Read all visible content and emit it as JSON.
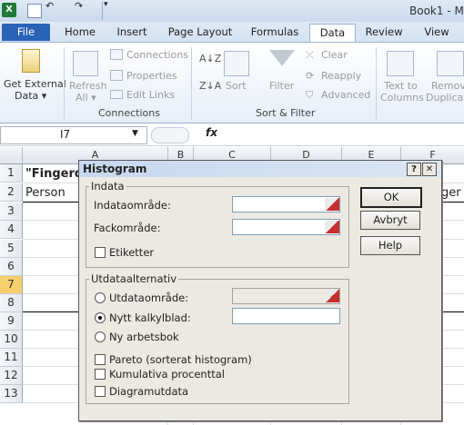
{
  "titlebar": {
    "title": "Book1 - Mi",
    "undo": "↶",
    "redo": "↷",
    "app_icon": "X"
  },
  "tabs": [
    {
      "label": "File"
    },
    {
      "label": "Home"
    },
    {
      "label": "Insert"
    },
    {
      "label": "Page Layout"
    },
    {
      "label": "Formulas"
    },
    {
      "label": "Data"
    },
    {
      "label": "Review"
    },
    {
      "label": "View"
    }
  ],
  "ribbon": {
    "get_external": [
      "Get External",
      "Data ▾"
    ],
    "connections": {
      "refresh": [
        "Refresh",
        "All ▾"
      ],
      "items": [
        "Connections",
        "Properties",
        "Edit Links"
      ],
      "group": "Connections"
    },
    "sort": {
      "sort": "Sort",
      "filter": "Filter",
      "items": [
        "Clear",
        "Reapply",
        "Advanced"
      ],
      "group": "Sort & Filter"
    },
    "tools": {
      "text_to_columns": [
        "Text to",
        "Columns"
      ],
      "remove_dup": [
        "Remov",
        "Duplica"
      ]
    }
  },
  "formula_bar": {
    "name_box": "I7",
    "fx": "fx"
  },
  "columns": [
    "A",
    "B",
    "C",
    "D",
    "E",
    "F"
  ],
  "rows": [
    "1",
    "2",
    "3",
    "4",
    "5",
    "6",
    "7",
    "8",
    "9",
    "10",
    "11",
    "12",
    "13"
  ],
  "cells": {
    "a1": "\"Fingerda",
    "a2": "Person",
    "f2": "ger"
  },
  "dialog": {
    "title": "Histogram",
    "help_glyph": "?",
    "close_glyph": "✕",
    "input_group": "Indata",
    "input_range_label": "Indataområde:",
    "bin_range_label": "Fackområde:",
    "labels_label": "Etiketter",
    "output_group": "Utdataalternativ",
    "output_range_label": "Utdataområde:",
    "new_sheet_label": "Nytt kalkylblad:",
    "new_workbook_label": "Ny arbetsbok",
    "pareto_label": "Pareto (sorterat histogram)",
    "cumulative_label": "Kumulativa procenttal",
    "chart_label": "Diagramutdata",
    "ok": "OK",
    "cancel": "Avbryt",
    "help": "Help",
    "selected_output": "new_sheet"
  }
}
